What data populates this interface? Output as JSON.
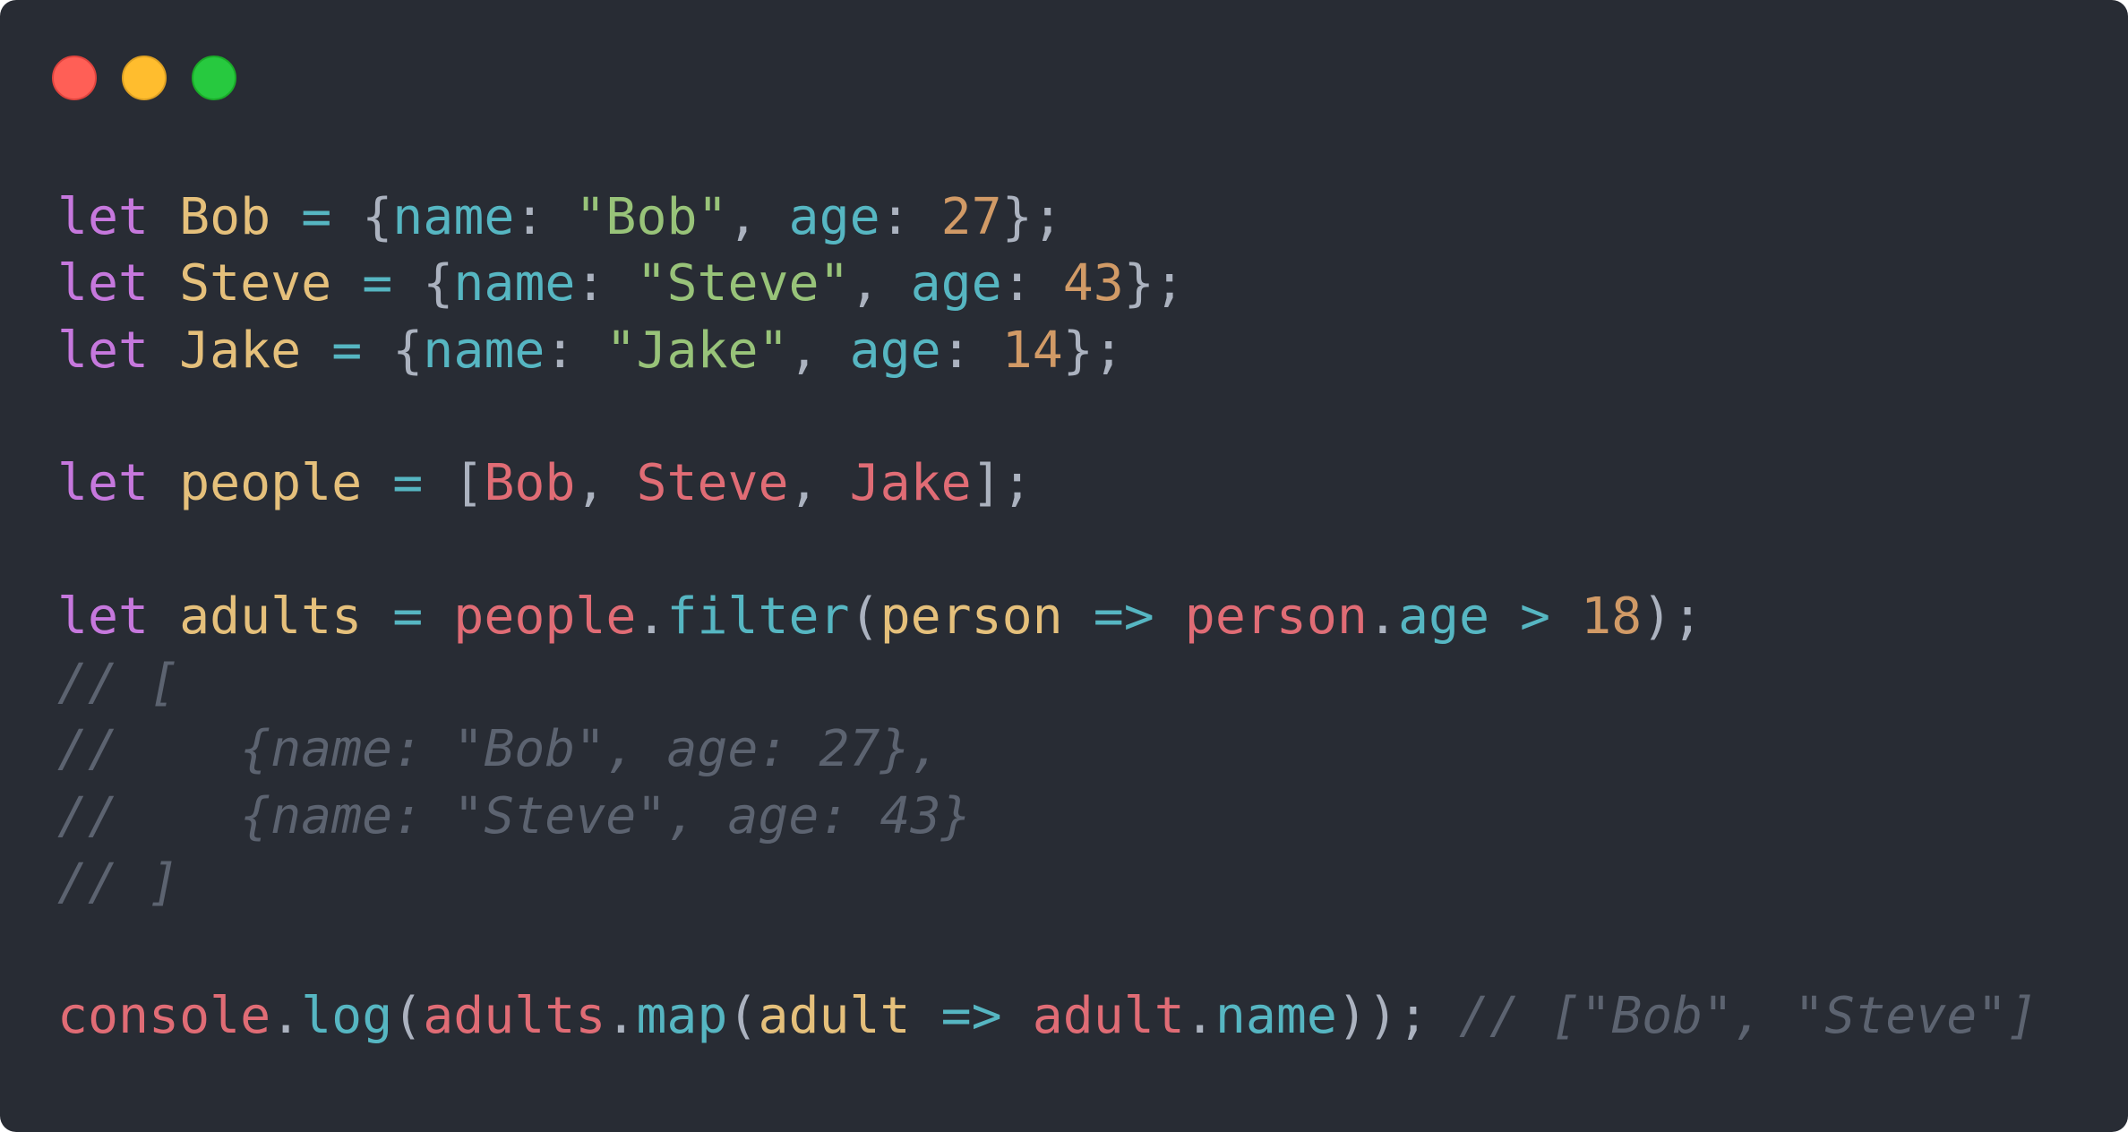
{
  "window": {
    "controls": [
      {
        "name": "close",
        "color": "#ff5f56"
      },
      {
        "name": "minimize",
        "color": "#ffbd2e"
      },
      {
        "name": "zoom",
        "color": "#27c93f"
      }
    ],
    "background": "#282c34"
  },
  "code": {
    "language": "javascript",
    "lines": [
      [
        {
          "t": "let",
          "c": "keyword"
        },
        {
          "t": " ",
          "c": "punct"
        },
        {
          "t": "Bob",
          "c": "def"
        },
        {
          "t": " ",
          "c": "punct"
        },
        {
          "t": "=",
          "c": "op"
        },
        {
          "t": " ",
          "c": "punct"
        },
        {
          "t": "{",
          "c": "punct"
        },
        {
          "t": "name",
          "c": "prop"
        },
        {
          "t": ": ",
          "c": "punct"
        },
        {
          "t": "\"Bob\"",
          "c": "string"
        },
        {
          "t": ", ",
          "c": "punct"
        },
        {
          "t": "age",
          "c": "prop"
        },
        {
          "t": ": ",
          "c": "punct"
        },
        {
          "t": "27",
          "c": "number"
        },
        {
          "t": "};",
          "c": "punct"
        }
      ],
      [
        {
          "t": "let",
          "c": "keyword"
        },
        {
          "t": " ",
          "c": "punct"
        },
        {
          "t": "Steve",
          "c": "def"
        },
        {
          "t": " ",
          "c": "punct"
        },
        {
          "t": "=",
          "c": "op"
        },
        {
          "t": " ",
          "c": "punct"
        },
        {
          "t": "{",
          "c": "punct"
        },
        {
          "t": "name",
          "c": "prop"
        },
        {
          "t": ": ",
          "c": "punct"
        },
        {
          "t": "\"Steve\"",
          "c": "string"
        },
        {
          "t": ", ",
          "c": "punct"
        },
        {
          "t": "age",
          "c": "prop"
        },
        {
          "t": ": ",
          "c": "punct"
        },
        {
          "t": "43",
          "c": "number"
        },
        {
          "t": "};",
          "c": "punct"
        }
      ],
      [
        {
          "t": "let",
          "c": "keyword"
        },
        {
          "t": " ",
          "c": "punct"
        },
        {
          "t": "Jake",
          "c": "def"
        },
        {
          "t": " ",
          "c": "punct"
        },
        {
          "t": "=",
          "c": "op"
        },
        {
          "t": " ",
          "c": "punct"
        },
        {
          "t": "{",
          "c": "punct"
        },
        {
          "t": "name",
          "c": "prop"
        },
        {
          "t": ": ",
          "c": "punct"
        },
        {
          "t": "\"Jake\"",
          "c": "string"
        },
        {
          "t": ", ",
          "c": "punct"
        },
        {
          "t": "age",
          "c": "prop"
        },
        {
          "t": ": ",
          "c": "punct"
        },
        {
          "t": "14",
          "c": "number"
        },
        {
          "t": "};",
          "c": "punct"
        }
      ],
      [],
      [
        {
          "t": "let",
          "c": "keyword"
        },
        {
          "t": " ",
          "c": "punct"
        },
        {
          "t": "people",
          "c": "def"
        },
        {
          "t": " ",
          "c": "punct"
        },
        {
          "t": "=",
          "c": "op"
        },
        {
          "t": " ",
          "c": "punct"
        },
        {
          "t": "[",
          "c": "punct"
        },
        {
          "t": "Bob",
          "c": "var"
        },
        {
          "t": ", ",
          "c": "punct"
        },
        {
          "t": "Steve",
          "c": "var"
        },
        {
          "t": ", ",
          "c": "punct"
        },
        {
          "t": "Jake",
          "c": "var"
        },
        {
          "t": "];",
          "c": "punct"
        }
      ],
      [],
      [
        {
          "t": "let",
          "c": "keyword"
        },
        {
          "t": " ",
          "c": "punct"
        },
        {
          "t": "adults",
          "c": "def"
        },
        {
          "t": " ",
          "c": "punct"
        },
        {
          "t": "=",
          "c": "op"
        },
        {
          "t": " ",
          "c": "punct"
        },
        {
          "t": "people",
          "c": "var"
        },
        {
          "t": ".",
          "c": "punct"
        },
        {
          "t": "filter",
          "c": "method"
        },
        {
          "t": "(",
          "c": "punct"
        },
        {
          "t": "person",
          "c": "param"
        },
        {
          "t": " ",
          "c": "punct"
        },
        {
          "t": "=>",
          "c": "op"
        },
        {
          "t": " ",
          "c": "punct"
        },
        {
          "t": "person",
          "c": "var"
        },
        {
          "t": ".",
          "c": "punct"
        },
        {
          "t": "age",
          "c": "prop"
        },
        {
          "t": " ",
          "c": "punct"
        },
        {
          "t": ">",
          "c": "op"
        },
        {
          "t": " ",
          "c": "punct"
        },
        {
          "t": "18",
          "c": "number"
        },
        {
          "t": ");",
          "c": "punct"
        }
      ],
      [
        {
          "t": "// [",
          "c": "comment"
        }
      ],
      [
        {
          "t": "//    {name: \"Bob\", age: 27},",
          "c": "comment"
        }
      ],
      [
        {
          "t": "//    {name: \"Steve\", age: 43}",
          "c": "comment"
        }
      ],
      [
        {
          "t": "// ]",
          "c": "comment"
        }
      ],
      [],
      [
        {
          "t": "console",
          "c": "var"
        },
        {
          "t": ".",
          "c": "punct"
        },
        {
          "t": "log",
          "c": "method"
        },
        {
          "t": "(",
          "c": "punct"
        },
        {
          "t": "adults",
          "c": "var"
        },
        {
          "t": ".",
          "c": "punct"
        },
        {
          "t": "map",
          "c": "method"
        },
        {
          "t": "(",
          "c": "punct"
        },
        {
          "t": "adult",
          "c": "param"
        },
        {
          "t": " ",
          "c": "punct"
        },
        {
          "t": "=>",
          "c": "op"
        },
        {
          "t": " ",
          "c": "punct"
        },
        {
          "t": "adult",
          "c": "var"
        },
        {
          "t": ".",
          "c": "punct"
        },
        {
          "t": "name",
          "c": "prop"
        },
        {
          "t": "));",
          "c": "punct"
        },
        {
          "t": " ",
          "c": "punct"
        },
        {
          "t": "// [\"Bob\", \"Steve\"]",
          "c": "comment"
        }
      ]
    ]
  }
}
